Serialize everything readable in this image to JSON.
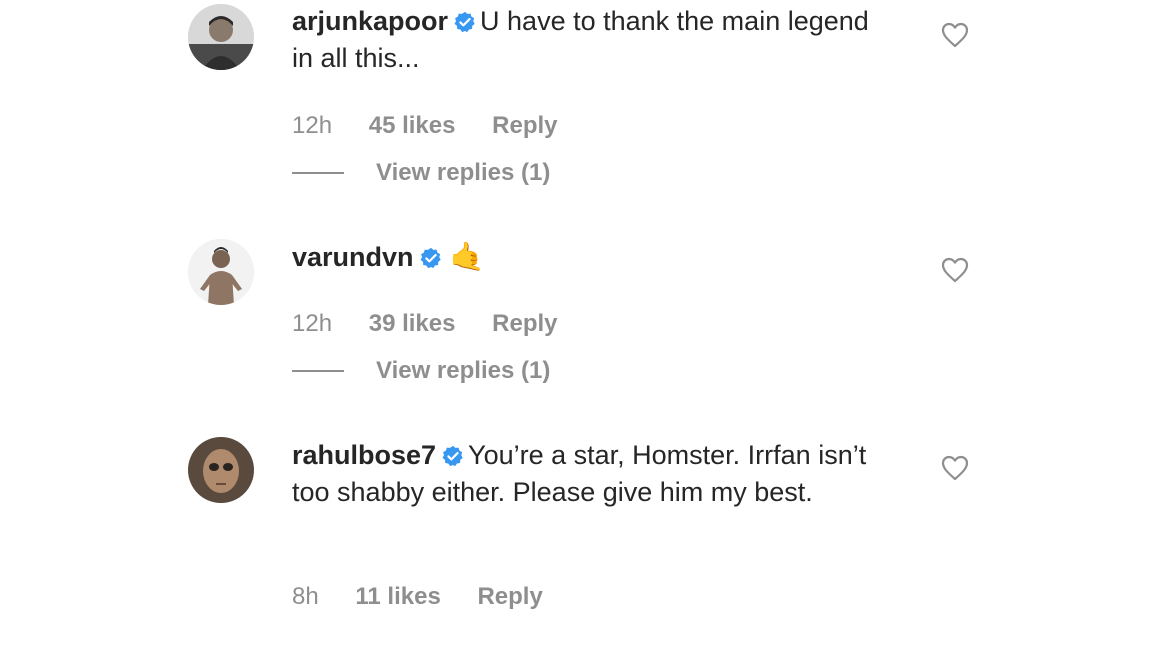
{
  "comments": [
    {
      "username": "arjunkapoor",
      "verified": true,
      "text": "U have to thank the main legend in all this...",
      "time": "12h",
      "likes": "45 likes",
      "reply": "Reply",
      "view_replies": "View replies (1)",
      "avatar_icon": "avatar-photo"
    },
    {
      "username": "varundvn",
      "verified": true,
      "text": "",
      "emoji": "🤙",
      "time": "12h",
      "likes": "39 likes",
      "reply": "Reply",
      "view_replies": "View replies (1)",
      "avatar_icon": "avatar-photo"
    },
    {
      "username": "rahulbose7",
      "verified": true,
      "text": "You’re a star, Homster. Irrfan isn’t too shabby either. Please give him my best.",
      "time": "8h",
      "likes": "11 likes",
      "reply": "Reply",
      "avatar_icon": "avatar-photo"
    }
  ],
  "colors": {
    "text": "#262626",
    "meta": "#8e8e8e",
    "verified_badge": "#3897f0",
    "heart_outline": "#8e8e8e"
  },
  "icons": {
    "like": "heart-outline-icon",
    "verified": "verified-badge-icon"
  }
}
